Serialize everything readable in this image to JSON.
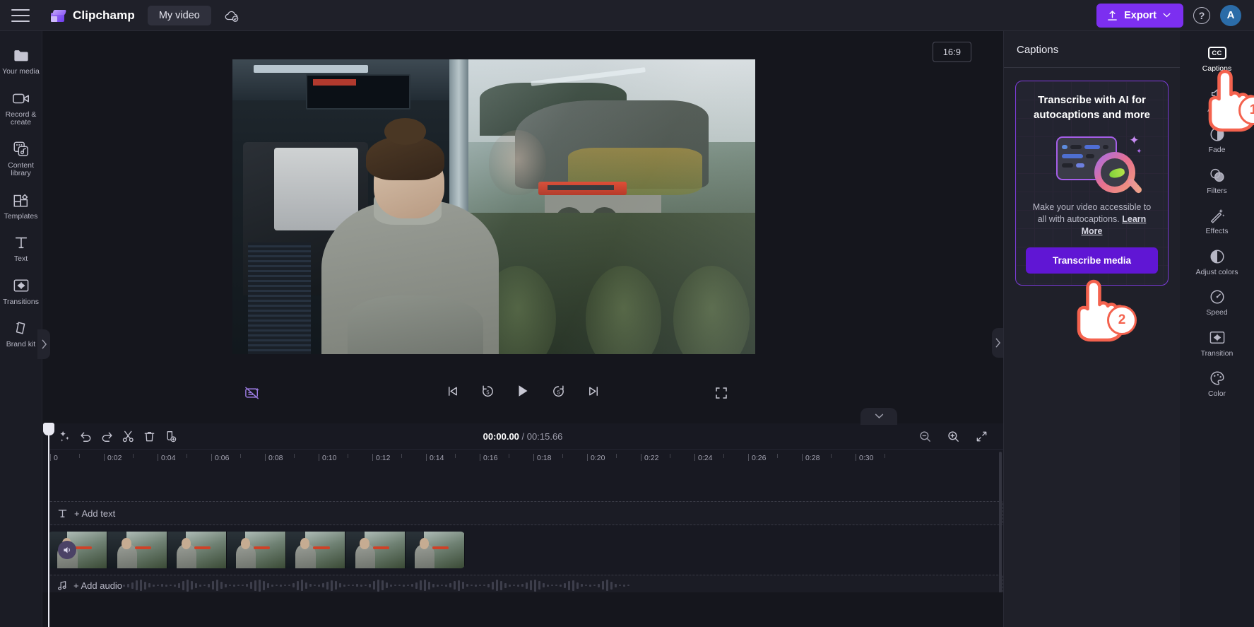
{
  "app": {
    "brand": "Clipchamp",
    "project_title": "My video"
  },
  "topbar": {
    "menu_icon": "hamburger-icon",
    "cloud_icon": "cloud-saved-icon",
    "export_label": "Export",
    "help_icon": "help-icon",
    "avatar_initial": "A"
  },
  "left_rail": [
    {
      "label": "Your media",
      "icon": "folder-icon"
    },
    {
      "label": "Record & create",
      "icon": "video-camera-icon"
    },
    {
      "label": "Content library",
      "icon": "library-icon"
    },
    {
      "label": "Templates",
      "icon": "templates-icon"
    },
    {
      "label": "Text",
      "icon": "text-icon"
    },
    {
      "label": "Transitions",
      "icon": "transitions-icon"
    },
    {
      "label": "Brand kit",
      "icon": "brand-kit-icon"
    }
  ],
  "stage": {
    "aspect_ratio": "16:9",
    "caption_toggle_icon": "captions-off-icon",
    "controls": [
      {
        "name": "skip-to-start",
        "icon": "skip-back-icon"
      },
      {
        "name": "rewind-5s",
        "icon": "rewind-5-icon"
      },
      {
        "name": "play",
        "icon": "play-icon"
      },
      {
        "name": "forward-5s",
        "icon": "forward-5-icon"
      },
      {
        "name": "skip-to-end",
        "icon": "skip-forward-icon"
      }
    ],
    "fullscreen_icon": "fullscreen-icon"
  },
  "right_panel": {
    "title": "Captions",
    "promo": {
      "title": "Transcribe with AI for autocaptions and more",
      "description": "Make your video accessible to all with autocaptions. ",
      "link_label": "Learn More",
      "button_label": "Transcribe media"
    }
  },
  "right_rail": [
    {
      "label": "Captions",
      "icon": "cc-icon",
      "active": true
    },
    {
      "label": "Audio",
      "icon": "audio-icon",
      "active": false
    },
    {
      "label": "Fade",
      "icon": "fade-icon",
      "active": false
    },
    {
      "label": "Filters",
      "icon": "filters-icon",
      "active": false
    },
    {
      "label": "Effects",
      "icon": "effects-icon",
      "active": false
    },
    {
      "label": "Adjust colors",
      "icon": "adjust-colors-icon",
      "active": false
    },
    {
      "label": "Speed",
      "icon": "speed-icon",
      "active": false
    },
    {
      "label": "Transition",
      "icon": "transition-icon",
      "active": false
    },
    {
      "label": "Color",
      "icon": "color-icon",
      "active": false
    }
  ],
  "timeline": {
    "tools": [
      {
        "name": "magic-tools",
        "icon": "sparkle-icon"
      },
      {
        "name": "undo",
        "icon": "undo-icon"
      },
      {
        "name": "redo",
        "icon": "redo-icon"
      },
      {
        "name": "split",
        "icon": "scissors-icon"
      },
      {
        "name": "delete",
        "icon": "trash-icon"
      },
      {
        "name": "duplicate",
        "icon": "duplicate-icon"
      }
    ],
    "current_time": "00:00.00",
    "total_time": "00:15.66",
    "separator": "/",
    "zoom_out_icon": "zoom-out-icon",
    "zoom_in_icon": "zoom-in-icon",
    "fit_icon": "fit-to-screen-icon",
    "ruler_ticks": [
      "0",
      "0:02",
      "0:04",
      "0:06",
      "0:08",
      "0:10",
      "0:12",
      "0:14",
      "0:16",
      "0:18",
      "0:20",
      "0:22",
      "0:24",
      "0:26",
      "0:28",
      "0:30"
    ],
    "add_text_label": "+ Add text",
    "add_text_icon": "text-icon",
    "add_audio_label": "+ Add audio",
    "add_audio_icon": "music-note-icon",
    "clip_audio_icon": "speaker-icon"
  },
  "annotations": [
    {
      "step": "1",
      "target": "captions-tab"
    },
    {
      "step": "2",
      "target": "transcribe-media-button"
    }
  ],
  "colors": {
    "accent_purple": "#7c2ff0",
    "button_purple": "#6016d4",
    "panel_bg": "#1f2029",
    "app_bg": "#15161d",
    "annotation_red": "#f4624e"
  }
}
